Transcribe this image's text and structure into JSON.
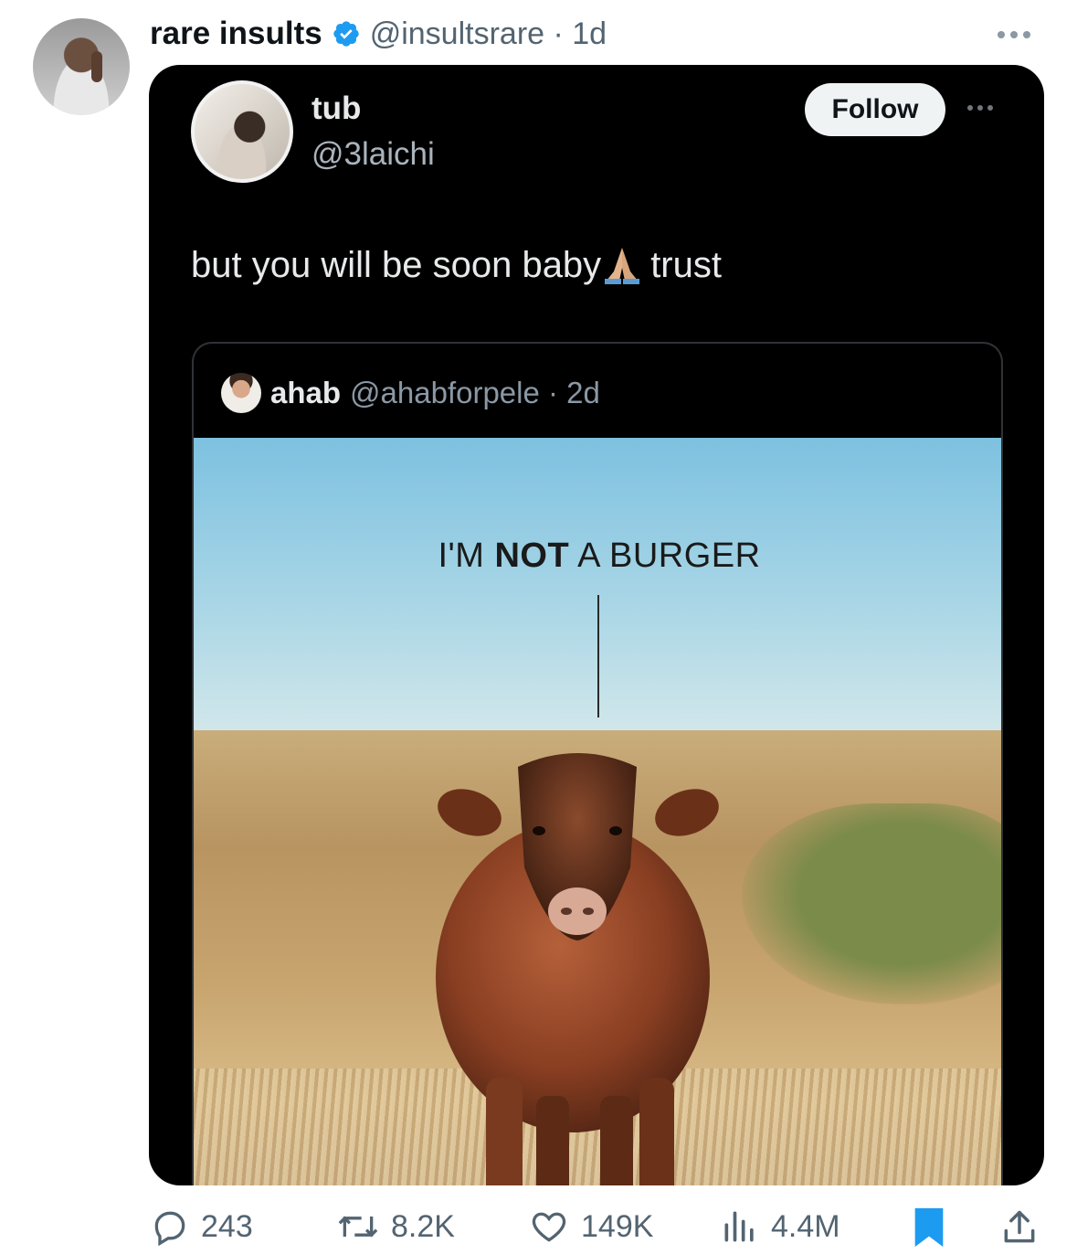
{
  "tweet": {
    "display_name": "rare insults",
    "handle_time": "@insultsrare · 1d"
  },
  "embedded": {
    "name": "tub",
    "handle": "@3laichi",
    "follow_label": "Follow",
    "text_before": "but you will be soon baby",
    "text_after": " trust",
    "quote": {
      "name": "ahab",
      "handle_time": "@ahabforpele · 2d",
      "image_caption_pre": "I'M ",
      "image_caption_bold": "NOT",
      "image_caption_post": " A BURGER"
    }
  },
  "actions": {
    "replies": "243",
    "reposts": "8.2K",
    "likes": "149K",
    "views": "4.4M"
  },
  "colors": {
    "verified": "#1d9bf0",
    "bookmark": "#1d9bf0",
    "muted": "#536471"
  },
  "icons": [
    "verified-icon",
    "more-icon",
    "reply-icon",
    "repost-icon",
    "like-icon",
    "views-icon",
    "bookmark-icon",
    "share-icon"
  ]
}
